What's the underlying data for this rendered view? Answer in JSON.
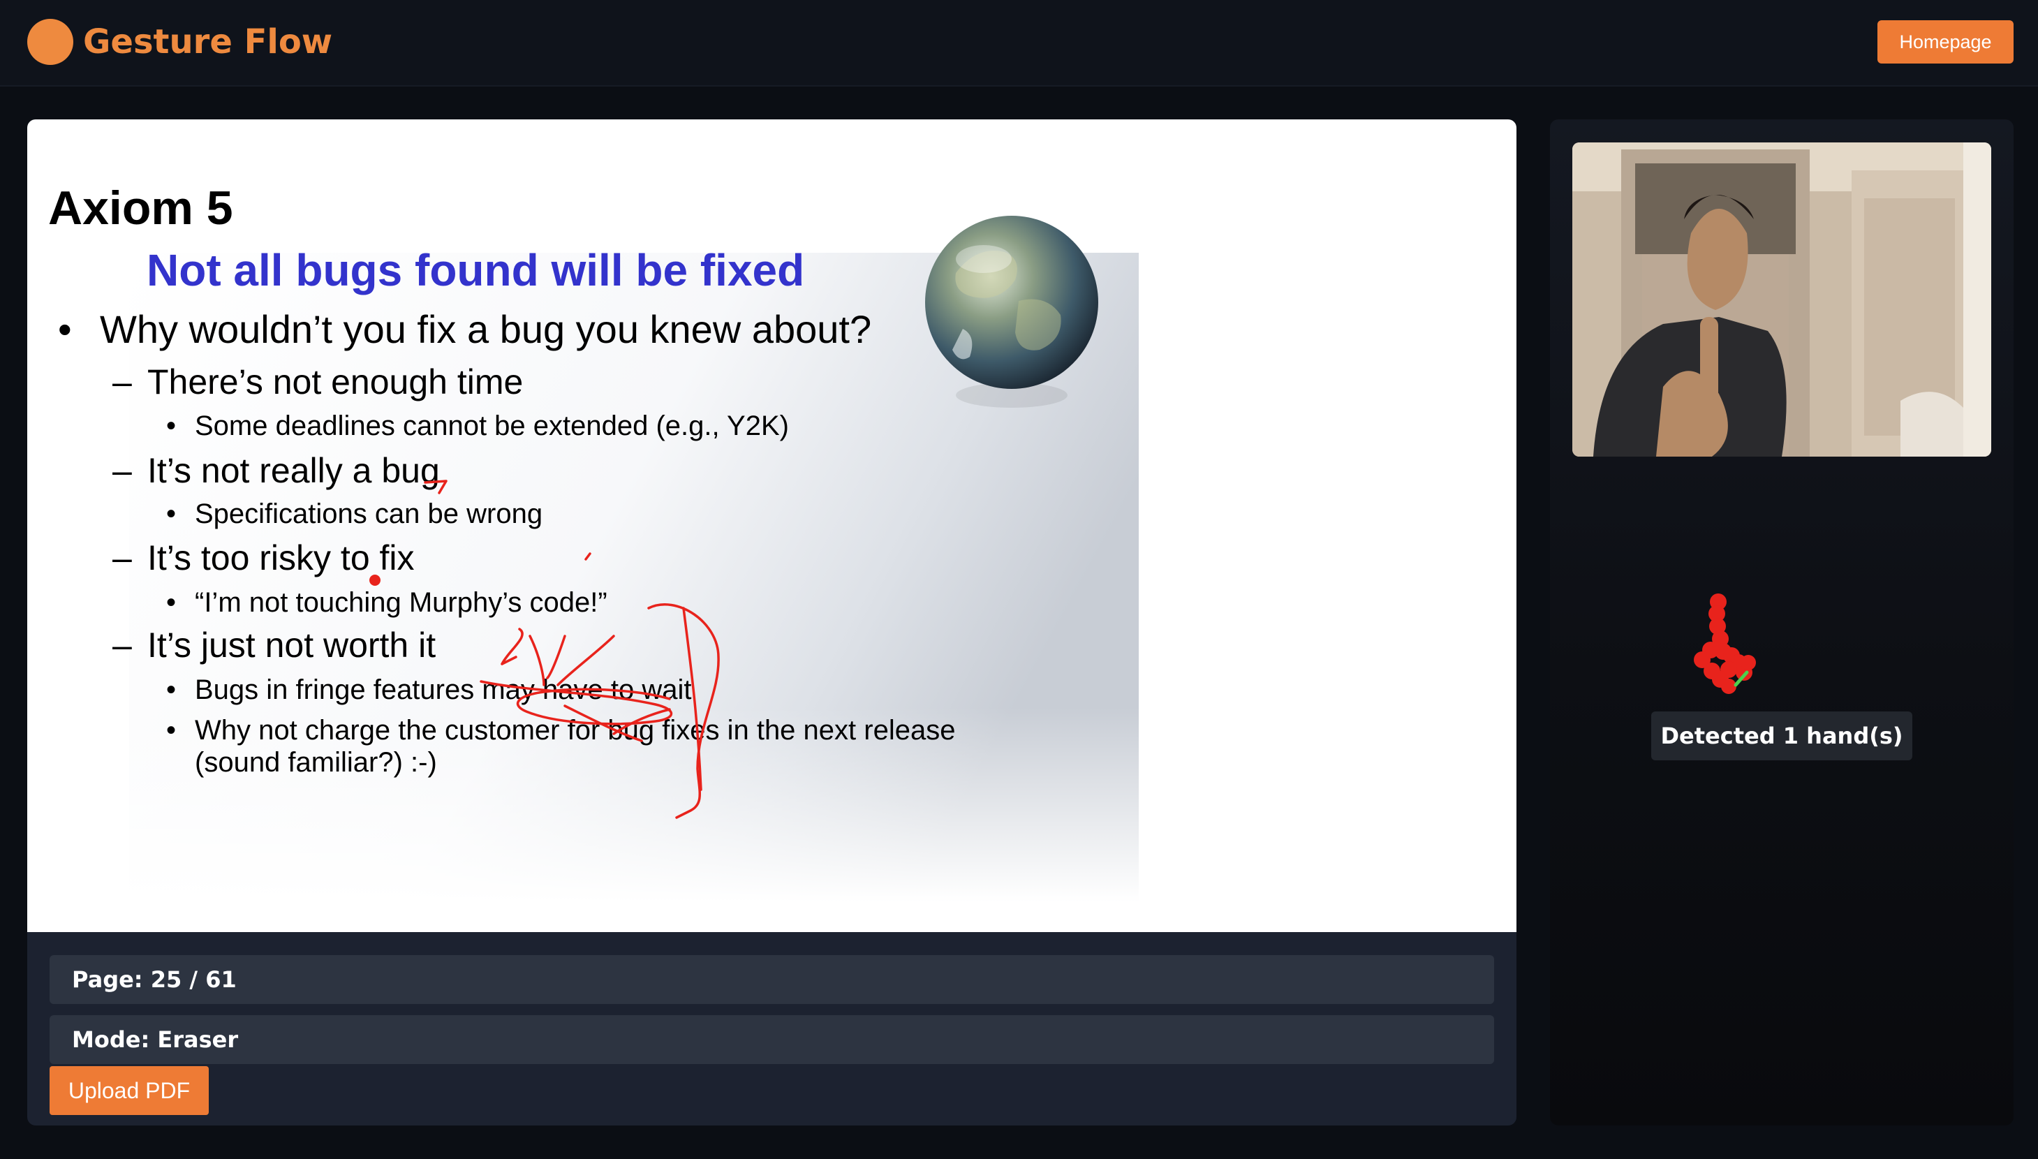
{
  "header": {
    "brand": "Gesture Flow",
    "homepage_label": "Homepage"
  },
  "slide": {
    "title": "Axiom 5",
    "subtitle": "Not all bugs found will be fixed",
    "bullet_1": "Why wouldn’t you fix a bug you knew about?",
    "sub_1": "There’s not enough time",
    "sub_1_detail": "Some deadlines cannot be extended (e.g., Y2K)",
    "sub_2": "It’s not really a bug",
    "sub_2_detail": "Specifications can be wrong",
    "sub_3": "It’s too risky to fix",
    "sub_3_detail": "“I’m not touching Murphy’s code!”",
    "sub_4": "It’s just not worth it",
    "sub_4_detail_1": "Bugs in fringe features may have to wait",
    "sub_4_detail_2_line1": "Why not charge the customer for bug fixes in the next release",
    "sub_4_detail_2_line2": "(sound familiar?) :-)",
    "bullet_glyph": "•",
    "dash_glyph": "–"
  },
  "status": {
    "page_text": "Page: 25 / 61",
    "mode_text": "Mode: Eraser"
  },
  "controls": {
    "upload_label": "Upload PDF"
  },
  "detection": {
    "label": "Detected 1 hand(s)"
  },
  "colors": {
    "accent": "#ee8a3f",
    "subtitle_blue": "#3333cc",
    "annotation_red": "#e8231c"
  }
}
